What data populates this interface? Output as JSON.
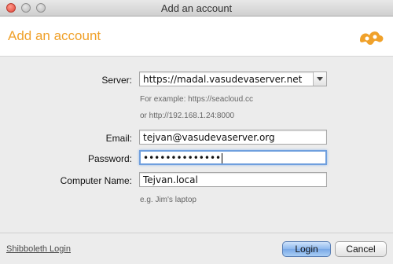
{
  "window": {
    "title": "Add an account"
  },
  "header": {
    "title": "Add an account",
    "logo_icon": "seafile-logo-icon"
  },
  "form": {
    "server": {
      "label": "Server:",
      "value": "https://madal.vasudevaserver.net"
    },
    "server_hint_1": "For example: https://seacloud.cc",
    "server_hint_2": "or http://192.168.1.24:8000",
    "email": {
      "label": "Email:",
      "value": "tejvan@vasudevaserver.org"
    },
    "password": {
      "label": "Password:",
      "value": "••••••••••••••"
    },
    "computer_name": {
      "label": "Computer Name:",
      "value": "Tejvan.local"
    },
    "computer_name_hint": "e.g. Jim's laptop"
  },
  "footer": {
    "shibboleth_label": "Shibboleth Login",
    "login_label": "Login",
    "cancel_label": "Cancel"
  },
  "colors": {
    "accent": "#f0a12a",
    "focus": "#6f9fde"
  }
}
